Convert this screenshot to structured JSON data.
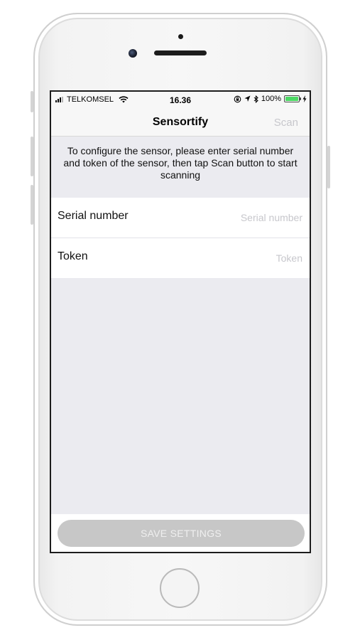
{
  "status_bar": {
    "carrier": "TELKOMSEL",
    "time": "16.36",
    "battery": "100%",
    "battery_level": 1.0,
    "battery_color": "#4cd964"
  },
  "nav": {
    "title": "Sensortify",
    "scan_label": "Scan"
  },
  "instructions": {
    "text": "To configure the sensor, please enter serial number and token of the sensor, then tap Scan button to start scanning"
  },
  "form": {
    "serial": {
      "label": "Serial number",
      "placeholder": "Serial number",
      "value": ""
    },
    "token": {
      "label": "Token",
      "placeholder": "Token",
      "value": ""
    }
  },
  "footer": {
    "save_label": "SAVE SETTINGS"
  },
  "icons": {
    "signal": "signal-bars-icon",
    "wifi": "wifi-icon",
    "orientation_lock": "orientation-lock-icon",
    "location": "location-arrow-icon",
    "bluetooth": "bluetooth-icon",
    "battery": "battery-icon",
    "charging": "charging-bolt-icon"
  },
  "colors": {
    "disabled_text": "#c7c7cc",
    "save_button_bg": "#c7c7c7",
    "background": "#ebebf0"
  }
}
